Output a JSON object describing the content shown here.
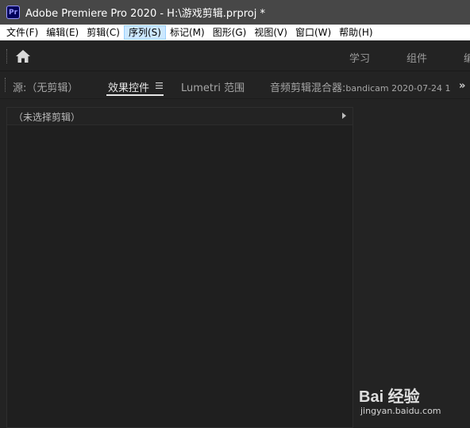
{
  "window": {
    "app_icon_text": "Pr",
    "title": "Adobe Premiere Pro 2020 - H:\\游戏剪辑.prproj *"
  },
  "menubar": {
    "items": [
      {
        "label": "文件(F)"
      },
      {
        "label": "编辑(E)"
      },
      {
        "label": "剪辑(C)"
      },
      {
        "label": "序列(S)"
      },
      {
        "label": "标记(M)"
      },
      {
        "label": "图形(G)"
      },
      {
        "label": "视图(V)"
      },
      {
        "label": "窗口(W)"
      },
      {
        "label": "帮助(H)"
      }
    ],
    "active_index": 3
  },
  "workspaces": {
    "home_icon": "home-icon",
    "tabs": [
      "学习",
      "组件",
      "编"
    ]
  },
  "panel_tabs": {
    "source": "源:（无剪辑）",
    "effect_controls": "效果控件",
    "effect_controls_menu_icon": "panel-menu-icon",
    "lumetri": "Lumetri 范围",
    "audio_mixer": "音频剪辑混合器:",
    "audio_mixer_clip": "bandicam 2020-07-24 1",
    "overflow_icon": "double-chevron-right-icon"
  },
  "effect_controls": {
    "header": "（未选择剪辑）",
    "expand_icon": "triangle-right-icon"
  },
  "watermark": {
    "main": "Bai 经验",
    "sub": "jingyan.baidu.com"
  },
  "colors": {
    "titlebar": "#474747",
    "menu_active": "#cce8ff",
    "panel_bg": "#232323",
    "pr_icon_bg": "#00005b",
    "pr_icon_fg": "#9999ff"
  }
}
